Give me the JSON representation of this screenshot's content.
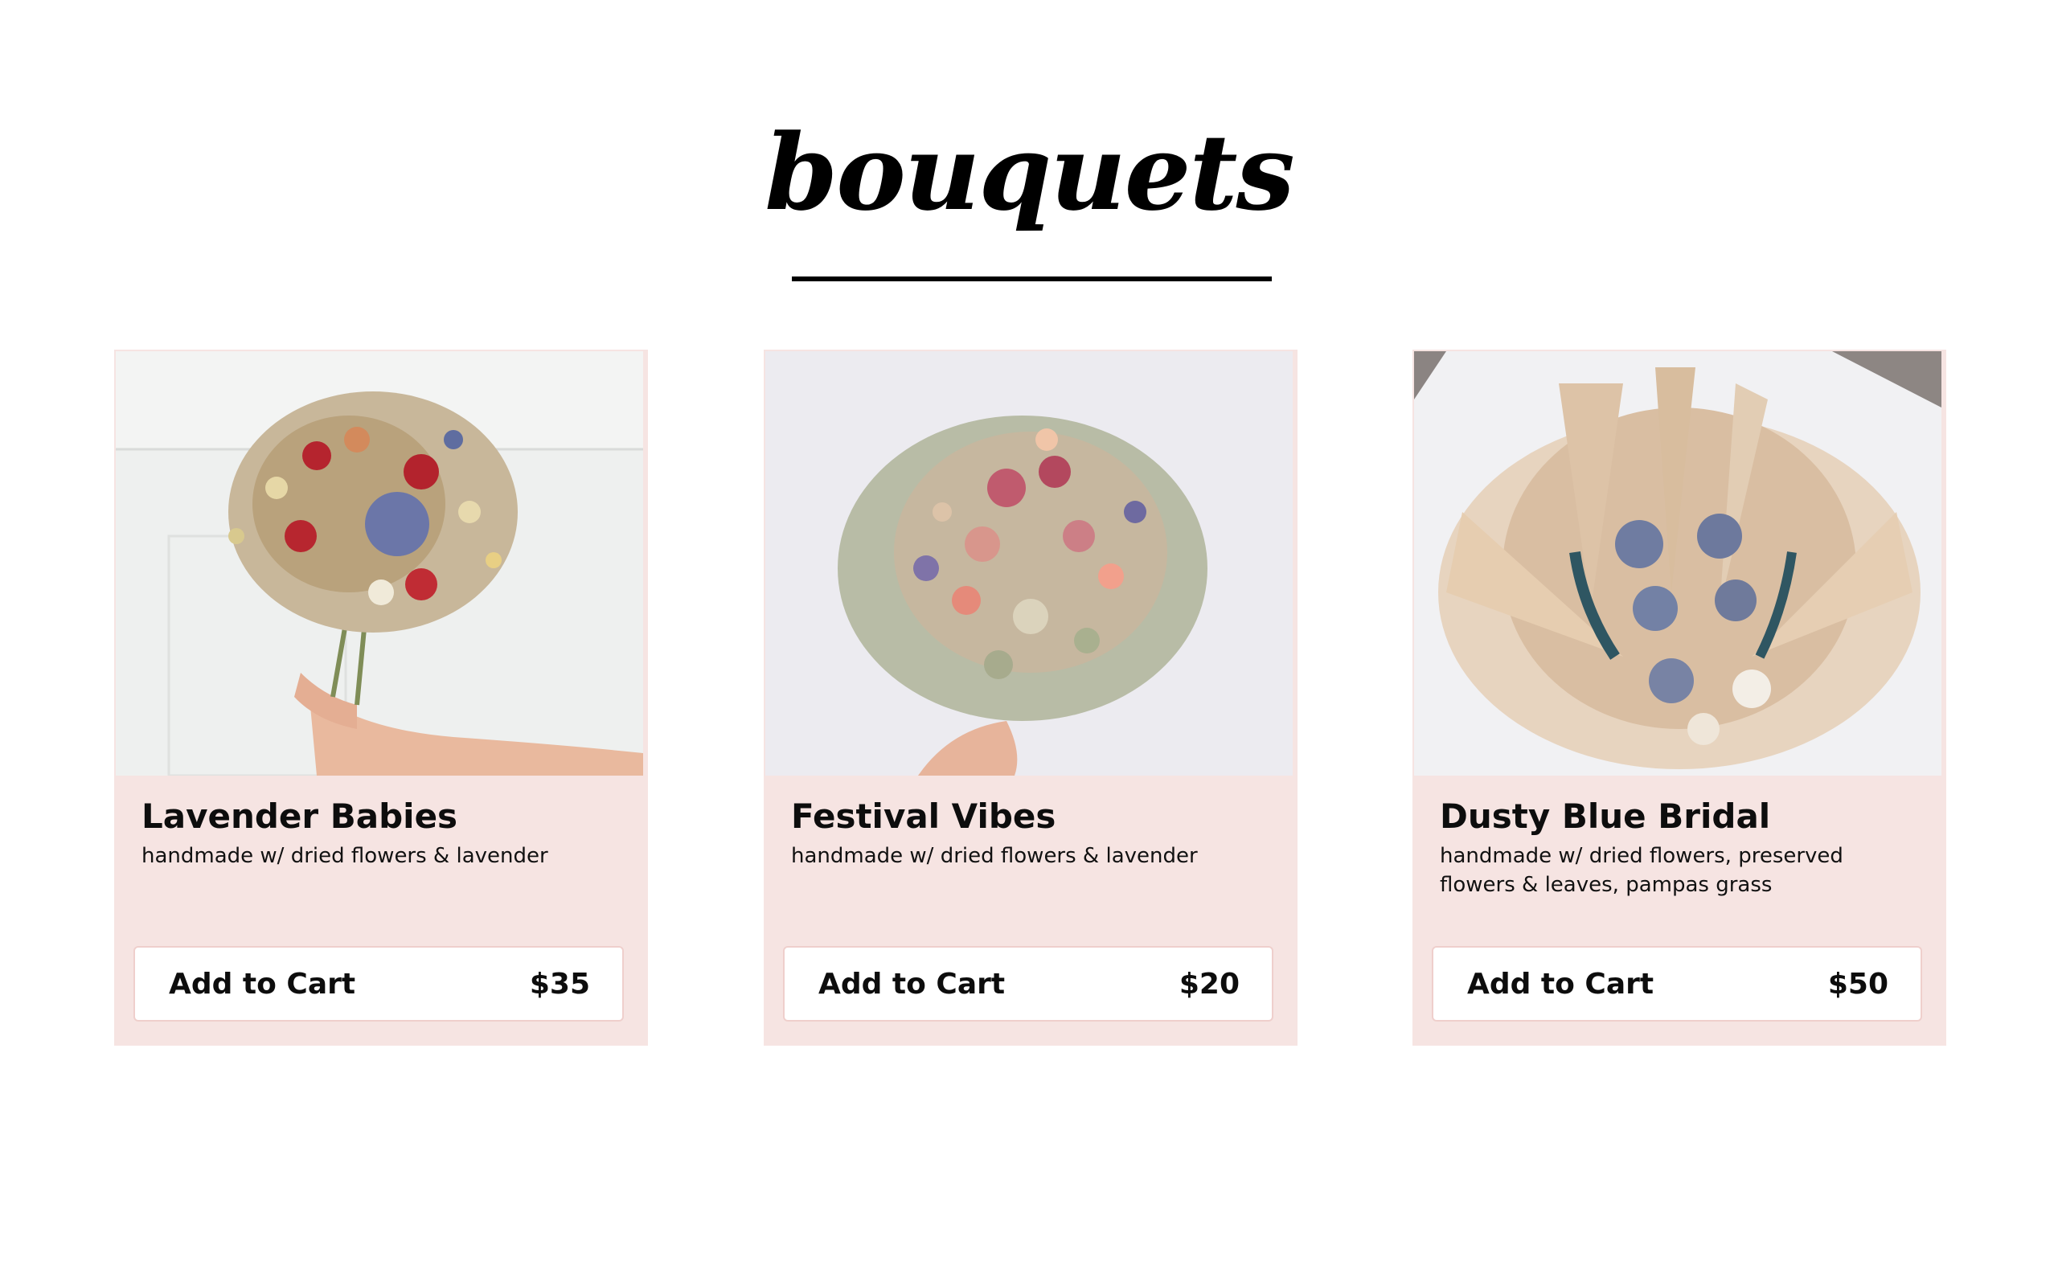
{
  "section": {
    "title": "bouquets"
  },
  "products": [
    {
      "name": "Lavender Babies",
      "description": "handmade w/ dried flowers & lavender",
      "cart_label": "Add to Cart",
      "price": "$35"
    },
    {
      "name": "Festival Vibes",
      "description": "handmade w/ dried flowers & lavender",
      "cart_label": "Add to Cart",
      "price": "$20"
    },
    {
      "name": "Dusty Blue Bridal",
      "description": "handmade w/ dried flowers, preserved flowers & leaves, pampas grass",
      "cart_label": "Add to Cart",
      "price": "$50"
    }
  ],
  "colors": {
    "card_background": "#f6e4e2",
    "button_border": "#efcfcc",
    "text": "#0d0d0d"
  }
}
